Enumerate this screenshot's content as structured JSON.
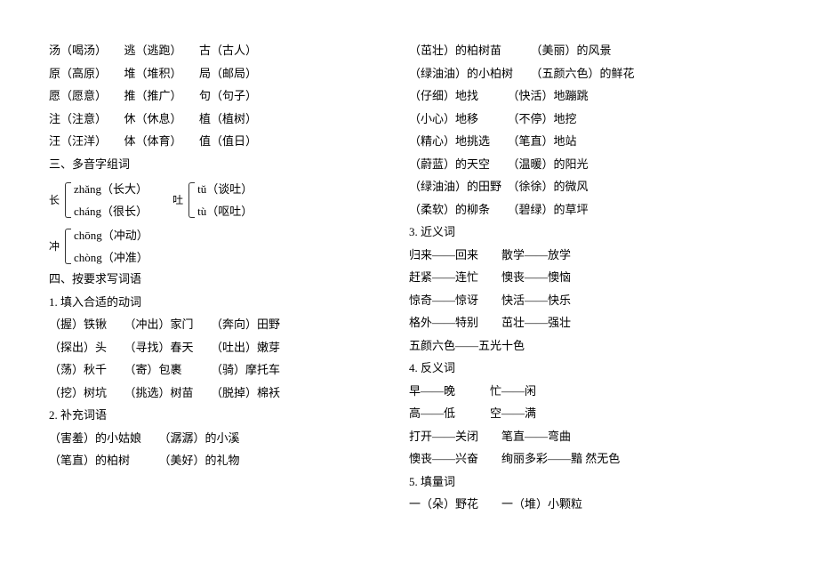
{
  "left": {
    "pair_rows": [
      "汤（喝汤）　　逃（逃跑）　　古（古人）",
      "原（高原）　　堆（堆积）　　局（邮局）",
      "愿（愿意）　　推（推广）　　句（句子）",
      "注（注意）　　休（休息）　　植（植树）",
      "汪（汪洋）　　体（体育）　　值（值日）"
    ],
    "section3_title": "三、多音字组词",
    "poly1": {
      "char": "长",
      "top": "zhǎng（长大）",
      "bot": "cháng（很长）"
    },
    "poly2": {
      "char": "吐",
      "top": "tǔ（谈吐）",
      "bot": "tù（呕吐）"
    },
    "poly3": {
      "char": "冲",
      "top": "chōng（冲动）",
      "bot": "chòng（冲准）"
    },
    "section4_title": "四、按要求写词语",
    "sub1_title": "1. 填入合适的动词",
    "sub1_rows": [
      "（握）铁锹　　（冲出）家门　　（奔向）田野",
      "（探出）头　　（寻找）春天　　（吐出）嫩芽",
      "（荡）秋千　　（寄）包裹　　　（骑）摩托车",
      "（挖）树坑　　（挑选）树苗　　（脱掉）棉袄"
    ],
    "sub2_title": "2. 补充词语",
    "sub2_rows": [
      "（害羞）的小姑娘　　（潺潺）的小溪",
      "（笔直）的柏树　　　（美好）的礼物"
    ]
  },
  "right": {
    "sub2_rows": [
      "（茁壮）的柏树苗　　　（美丽）的风景",
      "（绿油油）的小柏树　　（五颜六色）的鲜花",
      "（仔细）地找　　　（快活）地蹦跳",
      "（小心）地移　　　（不停）地挖",
      "（精心）地挑选　　（笔直）地站",
      "（蔚蓝）的天空　　（温暖）的阳光",
      "（绿油油）的田野　（徐徐）的微风",
      "（柔软）的柳条　　（碧绿）的草坪"
    ],
    "sub3_title": "3. 近义词",
    "sub3_rows": [
      "归来——回来　　散学——放学",
      "赶紧——连忙　　懊丧——懊恼",
      "惊奇——惊讶　　快活——快乐",
      "格外——特别　　茁壮——强壮",
      "五颜六色——五光十色"
    ],
    "sub4_title": "4. 反义词",
    "sub4_rows": [
      "早——晚　　　忙——闲",
      "高——低　　　空——满",
      "打开——关闭　　笔直——弯曲",
      "懊丧——兴奋　　绚丽多彩——黯 然无色"
    ],
    "sub5_title": "5. 填量词",
    "sub5_rows": [
      "一（朵）野花　　一（堆）小颗粒"
    ]
  }
}
